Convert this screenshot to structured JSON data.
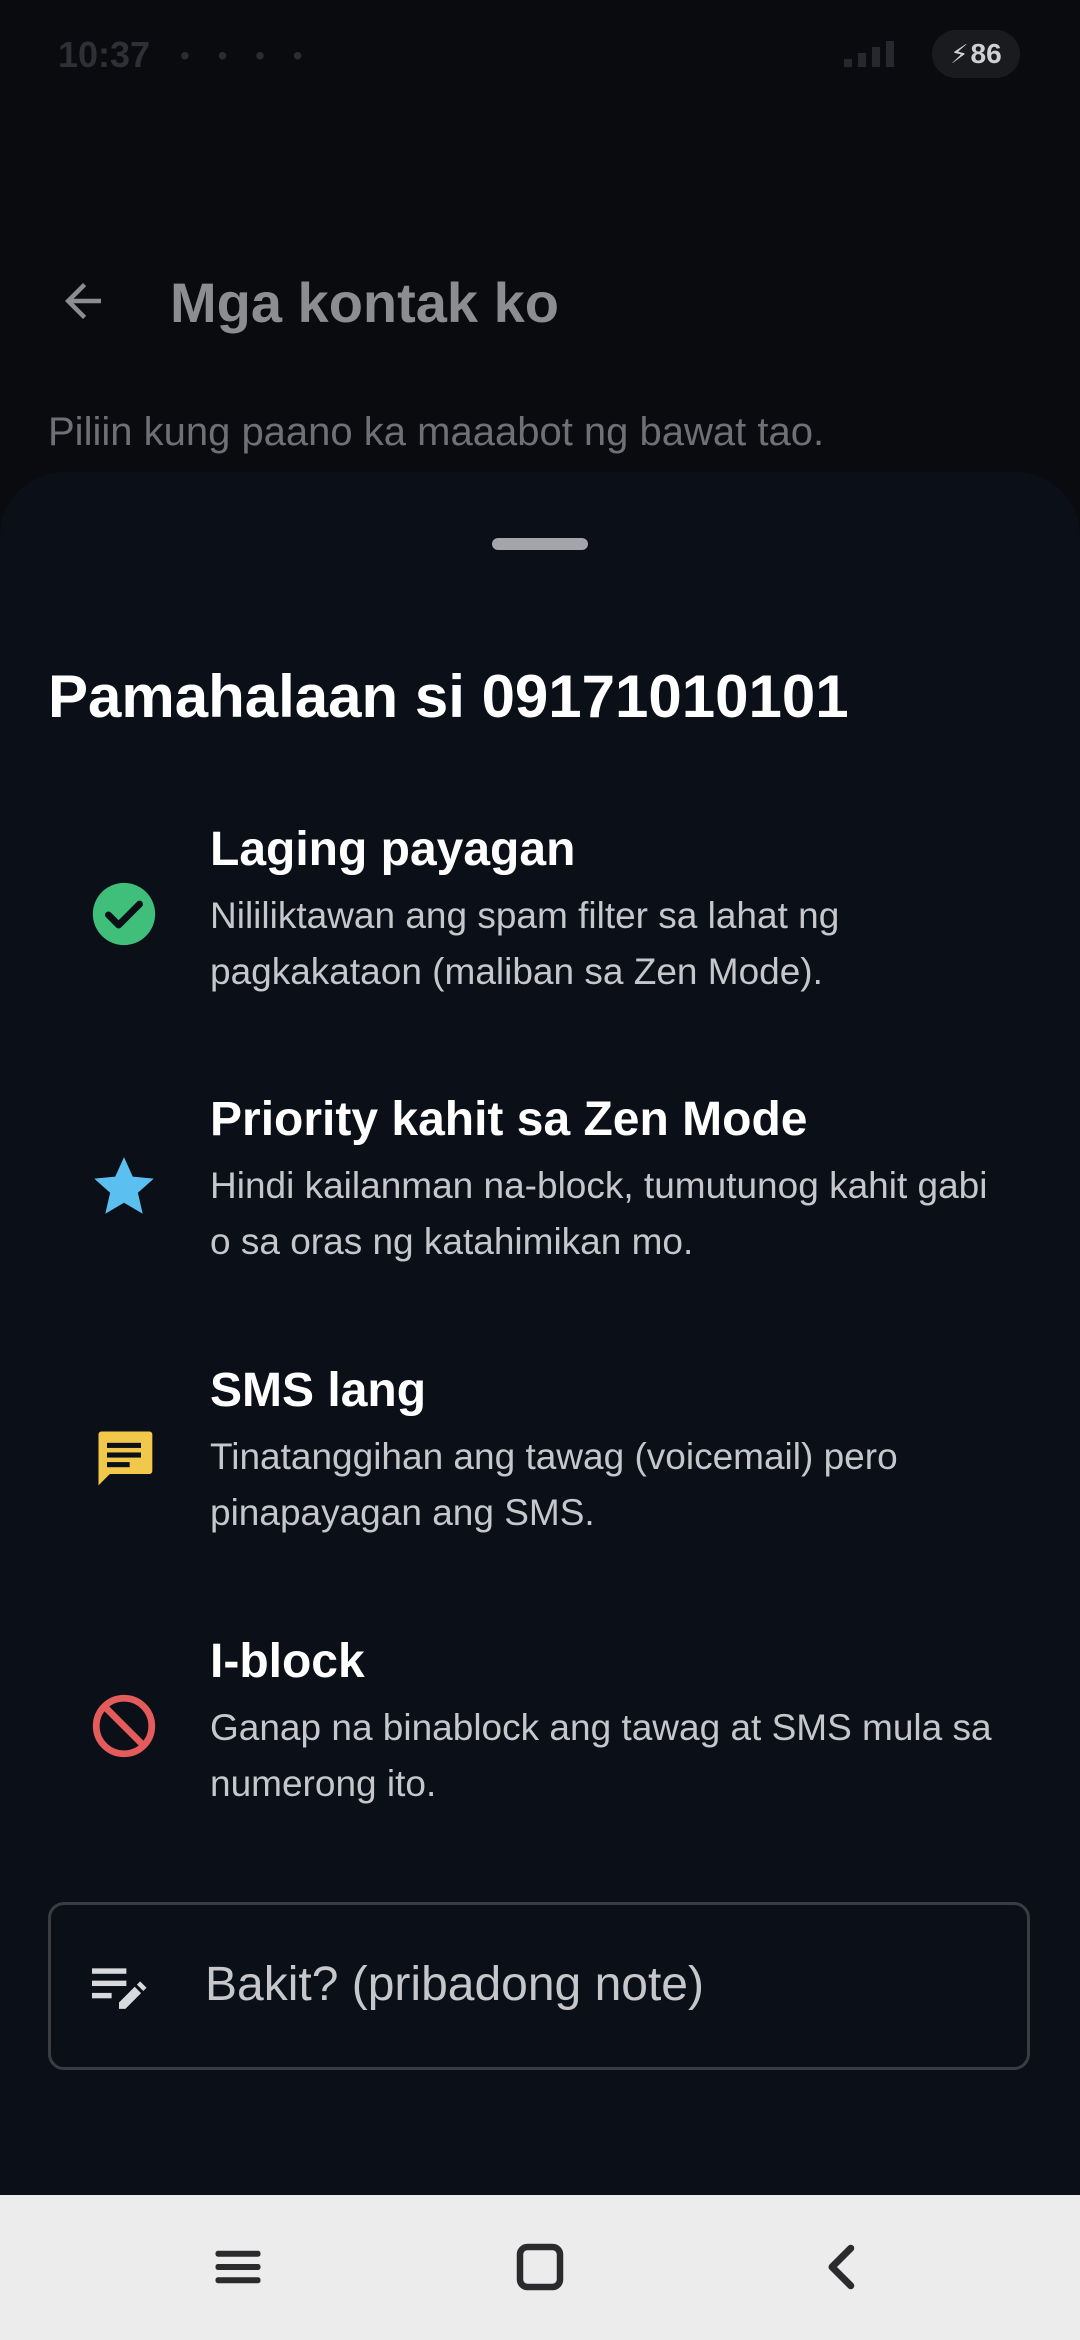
{
  "status_bar": {
    "time": "10:37",
    "notification_dots": "• • • •",
    "battery_level": "86",
    "battery_icon": "charging-bolt-icon"
  },
  "background_screen": {
    "title": "Mga kontak ko",
    "subtitle": "Piliin kung paano ka maaabot ng bawat tao.",
    "back_icon": "back-arrow-icon"
  },
  "sheet": {
    "title": "Pamahalaan si 09171010101",
    "options": [
      {
        "label": "Laging payagan",
        "description": "Nililiktawan ang spam filter sa lahat ng pagkakataon (maliban sa Zen Mode).",
        "icon": "check-circle-icon",
        "color": "#3fbf7a"
      },
      {
        "label": "Priority kahit sa Zen Mode",
        "description": "Hindi kailanman na-block, tumutunog kahit gabi o sa oras ng katahimikan mo.",
        "icon": "star-icon",
        "color": "#5bc0f0"
      },
      {
        "label": "SMS lang",
        "description": "Tinatanggihan ang tawag (voicemail) pero pinapayagan ang SMS.",
        "icon": "message-icon",
        "color": "#f2c84b"
      },
      {
        "label": "I-block",
        "description": "Ganap na binablock ang tawag at SMS mula sa numerong ito.",
        "icon": "block-icon",
        "color": "#e45b5b"
      }
    ],
    "note": {
      "placeholder": "Bakit? (pribadong note)",
      "icon": "edit-note-icon"
    }
  },
  "nav_bar": {
    "buttons": [
      "menu-icon",
      "home-square-icon",
      "back-chevron-icon"
    ]
  }
}
